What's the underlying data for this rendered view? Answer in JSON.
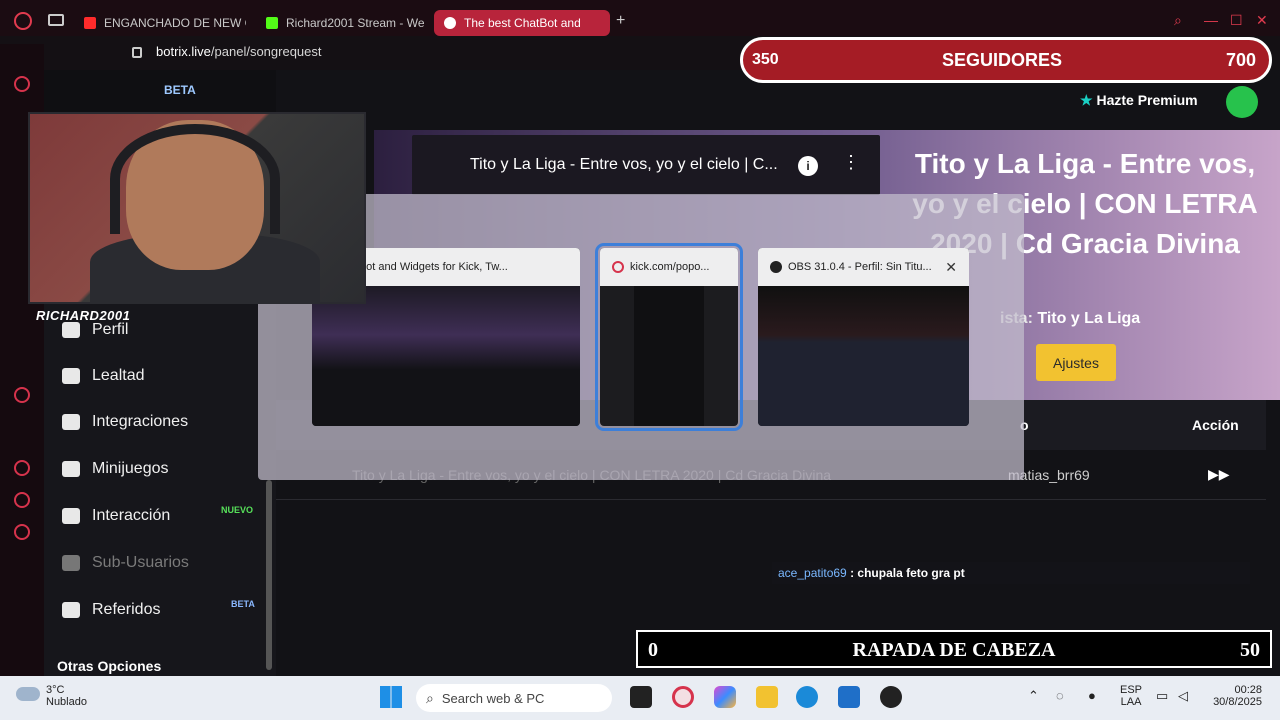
{
  "browser": {
    "tabs": [
      {
        "label": "ENGANCHADO DE NEW C",
        "color": "#ff2b2b"
      },
      {
        "label": "Richard2001 Stream - We",
        "color": "#53fc18"
      },
      {
        "label": "The best ChatBot and",
        "color": "#ffffff"
      }
    ],
    "url_host": "botrix.live",
    "url_path": "/panel/songrequest"
  },
  "sidebar": {
    "items": [
      {
        "label": "Perfil",
        "dim": false
      },
      {
        "label": "Lealtad",
        "dim": false
      },
      {
        "label": "Integraciones",
        "dim": false
      },
      {
        "label": "Minijuegos",
        "dim": false
      },
      {
        "label": "Interacción",
        "dim": false,
        "badge": "NUEVO"
      },
      {
        "label": "Sub-Usuarios",
        "dim": true
      },
      {
        "label": "Referidos",
        "dim": false,
        "badge": "BETA"
      }
    ],
    "otras": "Otras Opciones",
    "badge_colors": {
      "nuevo": "#57e15a",
      "beta": "#8ab8ff"
    }
  },
  "player": {
    "video_title": "Tito y La Liga - Entre vos, yo y el cielo | C...",
    "song_title": "Tito y La Liga - Entre vos, yo y el cielo | CON LETRA 2020 | Cd Gracia Divina",
    "artist_label": "ista:",
    "artist": "Tito y La Liga",
    "settings_button": "Ajustes"
  },
  "table": {
    "col_requested": "o",
    "col_action": "Acción",
    "rows": [
      {
        "title": "Tito y La Liga - Entre vos, yo y el cielo | CON LETRA 2020 | Cd Gracia Divina",
        "user": "matias_brr69"
      }
    ]
  },
  "premium": "Hazte Premium",
  "switcher": {
    "windows": [
      {
        "title": "st ChatBot and Widgets for Kick, Tw...",
        "selected": false
      },
      {
        "title": "kick.com/popo...",
        "selected": true
      },
      {
        "title": "OBS 31.0.4 - Perfil: Sin Titu...",
        "selected": false
      }
    ]
  },
  "overlay": {
    "beta_tag": "BETA",
    "streamer_name": "RICHARD2001",
    "followers_now": "350",
    "followers_label": "SEGUIDORES",
    "followers_goal": "700",
    "chat_user": "ace_patito69",
    "chat_message": " : chupala feto gra pt",
    "goal_left": "0",
    "goal_title": "RAPADA DE CABEZA",
    "goal_right": "50"
  },
  "taskbar": {
    "temp": "3°C",
    "weather": "Nublado",
    "search_placeholder": "Search web & PC",
    "lang_top": "ESP",
    "lang_bottom": "LAA",
    "time": "00:28",
    "date": "30/8/2025"
  }
}
